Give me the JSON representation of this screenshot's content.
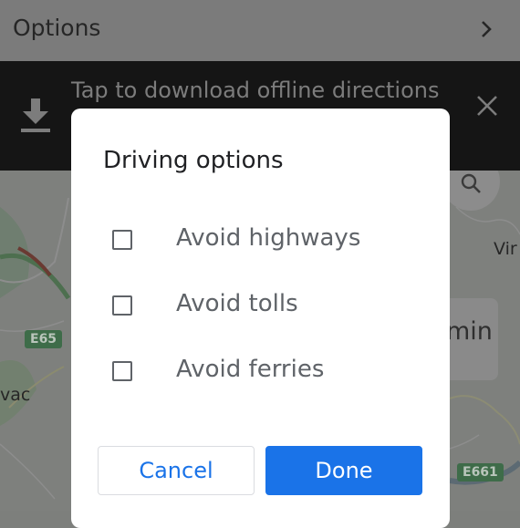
{
  "options_bar": {
    "label": "Options"
  },
  "offline_banner": {
    "message": "Tap to download offline directions"
  },
  "map": {
    "road_badges": [
      "E65",
      "E661"
    ],
    "places": [
      "Vir",
      "vac"
    ],
    "eta_fragment": "min"
  },
  "dialog": {
    "title": "Driving options",
    "options": [
      {
        "label": "Avoid highways",
        "checked": false
      },
      {
        "label": "Avoid tolls",
        "checked": false
      },
      {
        "label": "Avoid ferries",
        "checked": false
      }
    ],
    "cancel_label": "Cancel",
    "done_label": "Done"
  },
  "colors": {
    "accent": "#1a73e8",
    "scrim": "#7d7f7c",
    "banner_bg": "#151515"
  }
}
